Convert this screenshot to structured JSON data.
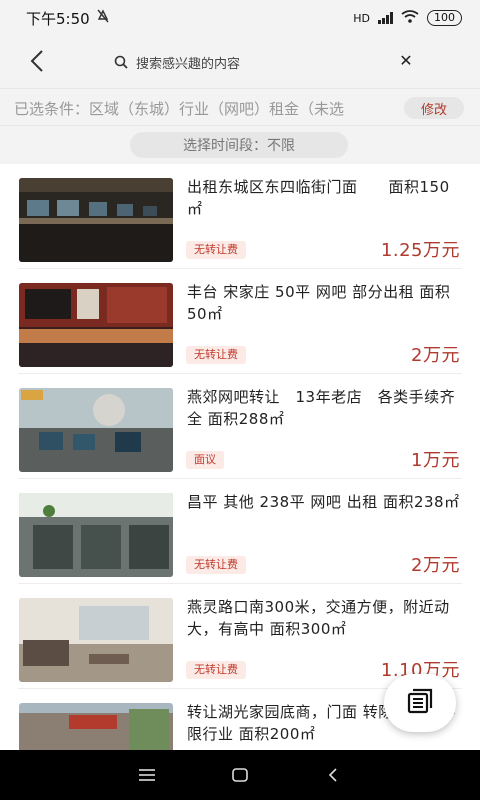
{
  "status_bar": {
    "time": "下午5:50",
    "mute_icon": "mute-icon",
    "signal": "HD",
    "battery": "100"
  },
  "header": {
    "back_icon": "back-arrow-icon",
    "search_placeholder": "搜索感兴趣的内容",
    "clear_icon": "close-icon"
  },
  "filters": {
    "summary": "已选条件：区域（东城）行业（网吧）租金（未选",
    "edit_label": "修改"
  },
  "time_filter": {
    "label": "选择时间段：不限"
  },
  "listings": [
    {
      "title": "出租东城区东四临街门面　　面积150㎡",
      "tag": "无转让费",
      "price": "1.25万元"
    },
    {
      "title": "丰台 宋家庄 50平 网吧 部分出租 面积50㎡",
      "tag": "无转让费",
      "price": "2万元"
    },
    {
      "title": "燕郊网吧转让　13年老店　各类手续齐全 面积288㎡",
      "tag": "面议",
      "price": "1万元"
    },
    {
      "title": "昌平 其他 238平 网吧 出租 面积238㎡",
      "tag": "无转让费",
      "price": "2万元"
    },
    {
      "title": "燕灵路口南300米，交通方便，附近动大，有高中 面积300㎡",
      "tag": "无转让费",
      "price": "1.10万元"
    },
    {
      "title": "转让湖光家园底商，门面 转除餐饮外不限行业 面积200㎡",
      "tag": "",
      "price": ""
    }
  ],
  "fab": {
    "icon": "list-document-icon"
  },
  "colors": {
    "accent": "#b03a2e",
    "tag_bg": "#fbeae6",
    "bar_bg": "#f3f3f3"
  }
}
